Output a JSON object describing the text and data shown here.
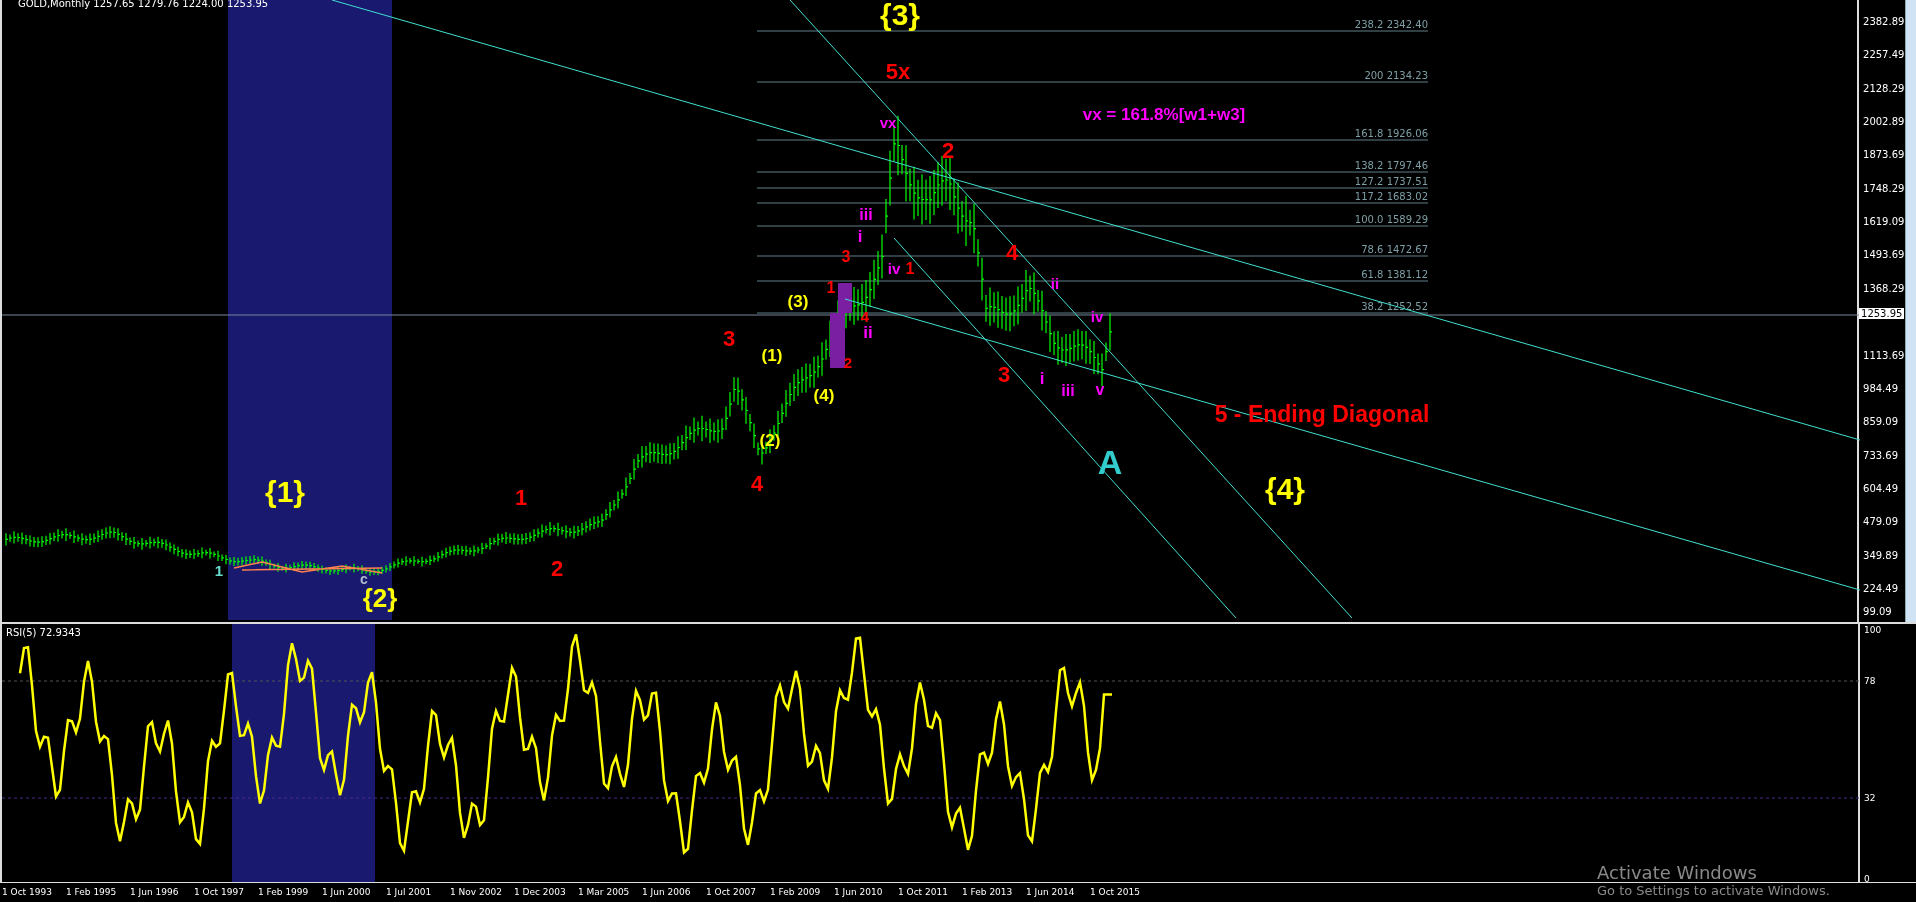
{
  "title": "GOLD,Monthly 1257.65 1279.76 1224.00 1253.95",
  "price_axis": {
    "labels": [
      "2382.89",
      "2257.49",
      "2128.29",
      "2002.89",
      "1873.69",
      "1748.29",
      "1619.09",
      "1493.69",
      "1368.29",
      "1113.69",
      "984.49",
      "859.09",
      "733.69",
      "604.49",
      "479.09",
      "349.89",
      "224.49",
      "99.09"
    ],
    "current_price": "1253.95"
  },
  "fibonacci_levels": [
    {
      "label": "238.2 2342.40"
    },
    {
      "label": "200 2134.23"
    },
    {
      "label": "161.8 1926.06"
    },
    {
      "label": "138.2 1797.46"
    },
    {
      "label": "127.2 1737.51"
    },
    {
      "label": "117.2 1683.02"
    },
    {
      "label": "100.0   1589.29"
    },
    {
      "label": "78.6 1472.67"
    },
    {
      "label": "61.8 1381.12"
    },
    {
      "label": "38.2 1252.52"
    }
  ],
  "wave_labels": [
    {
      "text": "{3}",
      "color": "#ffff00"
    },
    {
      "text": "5x",
      "color": "#ff0000"
    },
    {
      "text": "vx",
      "color": "#ff00ff"
    },
    {
      "text": "vx = 161.8%[w1+w3]",
      "color": "#ff00ff"
    },
    {
      "text": "2",
      "color": "#ff0000"
    },
    {
      "text": "iii",
      "color": "#ff00ff"
    },
    {
      "text": "3",
      "color": "#ff0000"
    },
    {
      "text": "i",
      "color": "#ff00ff"
    },
    {
      "text": "4",
      "color": "#ff0000"
    },
    {
      "text": "iv",
      "color": "#ff00ff"
    },
    {
      "text": "1",
      "color": "#ff0000"
    },
    {
      "text": "1",
      "color": "#ff0000"
    },
    {
      "text": "ii",
      "color": "#ff00ff"
    },
    {
      "text": "ii",
      "color": "#ff00ff"
    },
    {
      "text": "(3)",
      "color": "#ffff00"
    },
    {
      "text": "4",
      "color": "#ff0000"
    },
    {
      "text": "iv",
      "color": "#ff00ff"
    },
    {
      "text": "3",
      "color": "#ff0000"
    },
    {
      "text": "(1)",
      "color": "#ffff00"
    },
    {
      "text": "2",
      "color": "#ff0000"
    },
    {
      "text": "3",
      "color": "#ff0000"
    },
    {
      "text": "i",
      "color": "#ff00ff"
    },
    {
      "text": "(4)",
      "color": "#ffff00"
    },
    {
      "text": "iii",
      "color": "#ff00ff"
    },
    {
      "text": "v",
      "color": "#ff00ff"
    },
    {
      "text": "5 - Ending Diagonal",
      "color": "#ff0000"
    },
    {
      "text": "(2)",
      "color": "#ffff00"
    },
    {
      "text": "A",
      "color": "#33cccc"
    },
    {
      "text": "{1}",
      "color": "#ffff00"
    },
    {
      "text": "1",
      "color": "#ff0000"
    },
    {
      "text": "4",
      "color": "#ff0000"
    },
    {
      "text": "{4}",
      "color": "#ffff00"
    },
    {
      "text": "1",
      "color": "#66ddcc"
    },
    {
      "text": "2",
      "color": "#ff0000"
    },
    {
      "text": "c",
      "color": "#aabbcc"
    },
    {
      "text": "{2}",
      "color": "#ffff00"
    }
  ],
  "rsi": {
    "title": "RSI(5) 72.9343",
    "levels": [
      "100",
      "78",
      "32",
      "0"
    ]
  },
  "time_axis": {
    "labels": [
      "1 Oct 1993",
      "1 Feb 1995",
      "1 Jun 1996",
      "1 Oct 1997",
      "1 Feb 1999",
      "1 Jun 2000",
      "1 Jul 2001",
      "1 Nov 2002",
      "1 Dec 2003",
      "1 Mar 2005",
      "1 Jun 2006",
      "1 Oct 2007",
      "1 Feb 2009",
      "1 Jun 2010",
      "1 Oct 2011",
      "1 Feb 2013",
      "1 Jun 2014",
      "1 Oct 2015"
    ]
  },
  "activation_notice": {
    "title": "Activate Windows",
    "hint": "Go to Settings to activate Windows."
  }
}
